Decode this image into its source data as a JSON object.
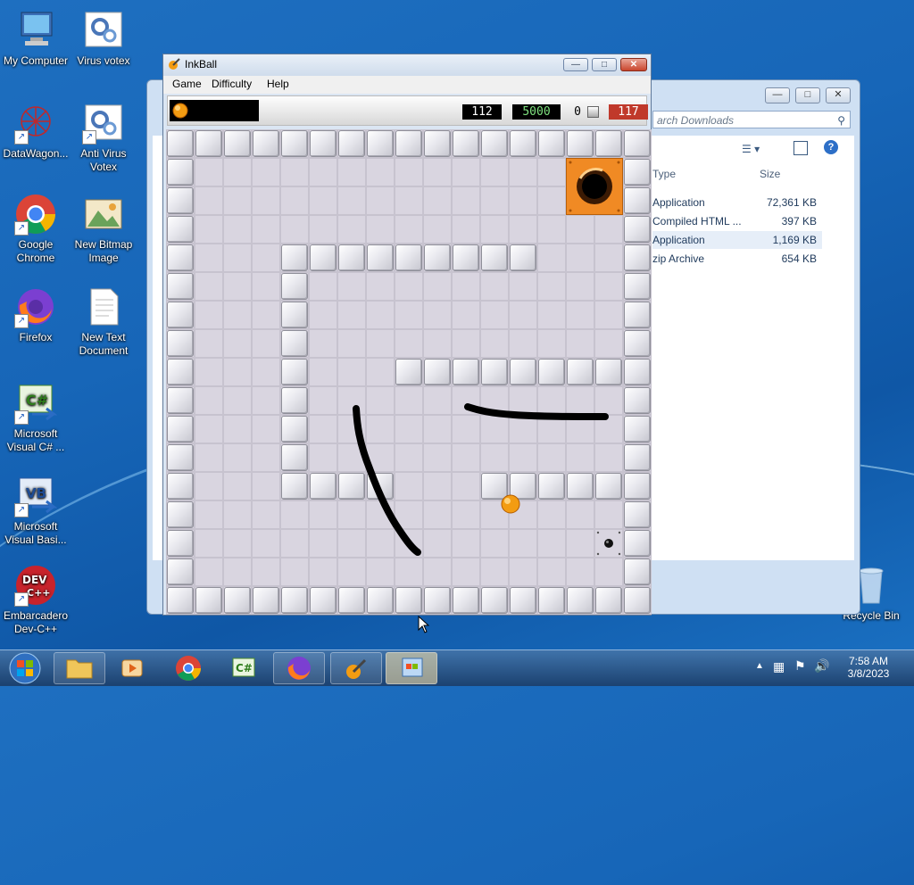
{
  "desktop": {
    "icons": [
      {
        "label": "My Computer"
      },
      {
        "label": "Virus votex"
      },
      {
        "label": "DataWagon..."
      },
      {
        "label": "Anti Virus Votex"
      },
      {
        "label": "Google Chrome"
      },
      {
        "label": "New Bitmap Image"
      },
      {
        "label": "Firefox"
      },
      {
        "label": "New Text Document"
      },
      {
        "label": "Microsoft Visual C# ..."
      },
      {
        "label": "Microsoft Visual Basi..."
      },
      {
        "label": "Embarcadero Dev-C++"
      },
      {
        "label": "Recycle Bin"
      }
    ]
  },
  "explorer": {
    "search_placeholder": "arch Downloads",
    "columns": {
      "type": "Type",
      "size": "Size"
    },
    "rows": [
      {
        "type": "Application",
        "size": "72,361 KB"
      },
      {
        "type": "Compiled HTML ...",
        "size": "397 KB"
      },
      {
        "type": "Application",
        "size": "1,169 KB"
      },
      {
        "type": "zip Archive",
        "size": "654 KB"
      }
    ]
  },
  "inkball": {
    "title": "InkBall",
    "menu": [
      "Game",
      "Difficulty",
      "Help"
    ],
    "time": "112",
    "high_score": "5000",
    "score": "0",
    "remaining": "117",
    "colors": {
      "time": "#000000",
      "high_score": "#000000",
      "remaining": "#c0392b",
      "goal": "#f08a24",
      "ball": "#f39c12",
      "ink": "#000000"
    }
  },
  "taskbar": {
    "time": "7:58 AM",
    "date": "3/8/2023",
    "tray_icons": [
      "show-hidden-icon",
      "network-icon",
      "flag-icon",
      "volume-icon"
    ]
  }
}
